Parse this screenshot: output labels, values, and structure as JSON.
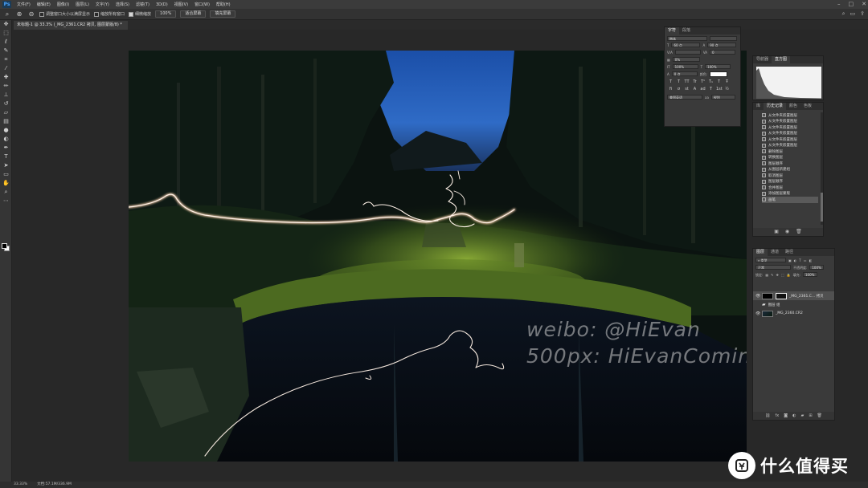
{
  "menubar": {
    "app_icon": "Ps",
    "items": [
      "文件(F)",
      "编辑(E)",
      "图像(I)",
      "图层(L)",
      "文字(Y)",
      "选择(S)",
      "滤镜(T)",
      "3D(D)",
      "视图(V)",
      "窗口(W)",
      "帮助(H)"
    ],
    "window_controls": [
      "minimize-icon",
      "maximize-icon",
      "close-icon"
    ]
  },
  "optionsbar": {
    "resize_windows_label": "调整窗口大小以满屏显示",
    "zoom_all_label": "缩放所有窗口",
    "scrubby_zoom_label": "细微缩放",
    "zoom_value": "100%",
    "fit_screen_label": "适合屏幕",
    "fill_screen_label": "填充屏幕"
  },
  "document_tab": {
    "title": "未标题-1 @ 33.3% (_MG_2361.CR2 拷贝, 图层蒙版/8) *"
  },
  "canvas": {
    "watermark_line1": "weibo: @HiEvan",
    "watermark_line2": "500px: HiEvanComing"
  },
  "character_panel": {
    "tabs": [
      "字符",
      "段落"
    ],
    "active_tab": "字符",
    "font_family": "楷体",
    "font_style": "",
    "font_size": "60 点",
    "leading": "90 点",
    "kerning": "",
    "tracking": "0",
    "scale_label": "0%",
    "vertical_scale": "100%",
    "horizontal_scale": "100%",
    "baseline": "0 点",
    "color_label": "颜色:",
    "format_buttons": [
      "T",
      "T",
      "TT",
      "Tr",
      "T¹",
      "T₁",
      "T",
      "Ŧ"
    ],
    "opentype_buttons": [
      "fi",
      "σ",
      "st",
      "A",
      "ad",
      "T",
      "1st",
      "½"
    ],
    "language": "美国英语",
    "antialias": "锐利"
  },
  "navigator_panel": {
    "tabs": [
      "导航器",
      "直方图"
    ],
    "active_tab": "直方图"
  },
  "history_panel": {
    "tabs": [
      "库",
      "历史记录",
      "颜色",
      "色板"
    ],
    "active_tab": "历史记录",
    "items": [
      "从文件夹嵌置图层",
      "从文件夹嵌置图层",
      "从文件夹嵌置图层",
      "从文件夹嵌置图层",
      "从文件夹嵌置图层",
      "从文件夹嵌置图层",
      "删除图层",
      "转换图层",
      "图层顺序",
      "从图层新建组",
      "取消图层",
      "图层顺序",
      "合并图层",
      "添加图层蒙版",
      "画笔"
    ],
    "selected_index": 14
  },
  "layers_panel": {
    "tabs": [
      "图层",
      "通道",
      "路径"
    ],
    "active_tab": "图层",
    "filter_label": "类型",
    "blend_mode": "正常",
    "opacity_label": "不透明度:",
    "opacity_value": "100%",
    "lock_label": "锁定:",
    "fill_label": "填充:",
    "fill_value": "100%",
    "layers": [
      {
        "name": "_MG_2361.C... 拷贝",
        "kind": "masked"
      },
      {
        "name": "图层 组",
        "kind": "group"
      },
      {
        "name": "_MG_2360.CR2",
        "kind": "photo"
      }
    ]
  },
  "statusbar": {
    "zoom": "33.33%",
    "doc_info": "文档:57.1M/336.9M"
  },
  "brand": {
    "icon": "smzdm-logo-icon",
    "text": "什么值得买"
  }
}
